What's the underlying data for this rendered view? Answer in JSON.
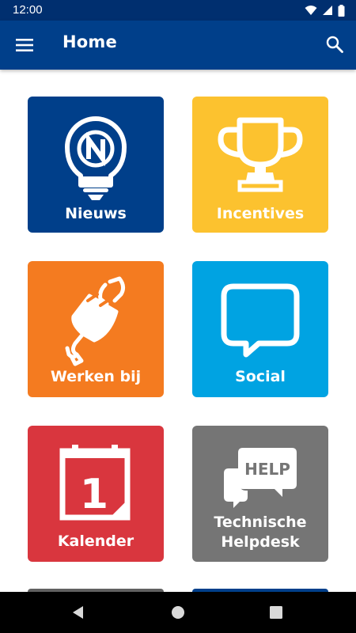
{
  "status_bar": {
    "time": "12:00",
    "icons": [
      "wifi-icon",
      "signal-icon",
      "battery-icon"
    ]
  },
  "app_bar": {
    "title": "Home",
    "left_icon": "menu-icon",
    "right_icon": "search-icon"
  },
  "tiles": [
    {
      "label": "Nieuws",
      "icon": "news-lightbulb-icon",
      "color": "#003f8a"
    },
    {
      "label": "Incentives",
      "icon": "trophy-icon",
      "color": "#fcc22f"
    },
    {
      "label": "Werken bij",
      "icon": "plug-wrench-icon",
      "color": "#f47b20"
    },
    {
      "label": "Social",
      "icon": "chat-bubble-icon",
      "color": "#00a3e2"
    },
    {
      "label": "Kalender",
      "icon": "calendar-icon",
      "color": "#d9363e",
      "icon_text": "1"
    },
    {
      "label_line1": "Technische",
      "label_line2": "Helpdesk",
      "icon": "help-chat-icon",
      "color": "#757575",
      "icon_text": "HELP"
    }
  ],
  "nav_bar": {
    "icons": [
      "back-icon",
      "home-icon",
      "recents-icon"
    ]
  }
}
